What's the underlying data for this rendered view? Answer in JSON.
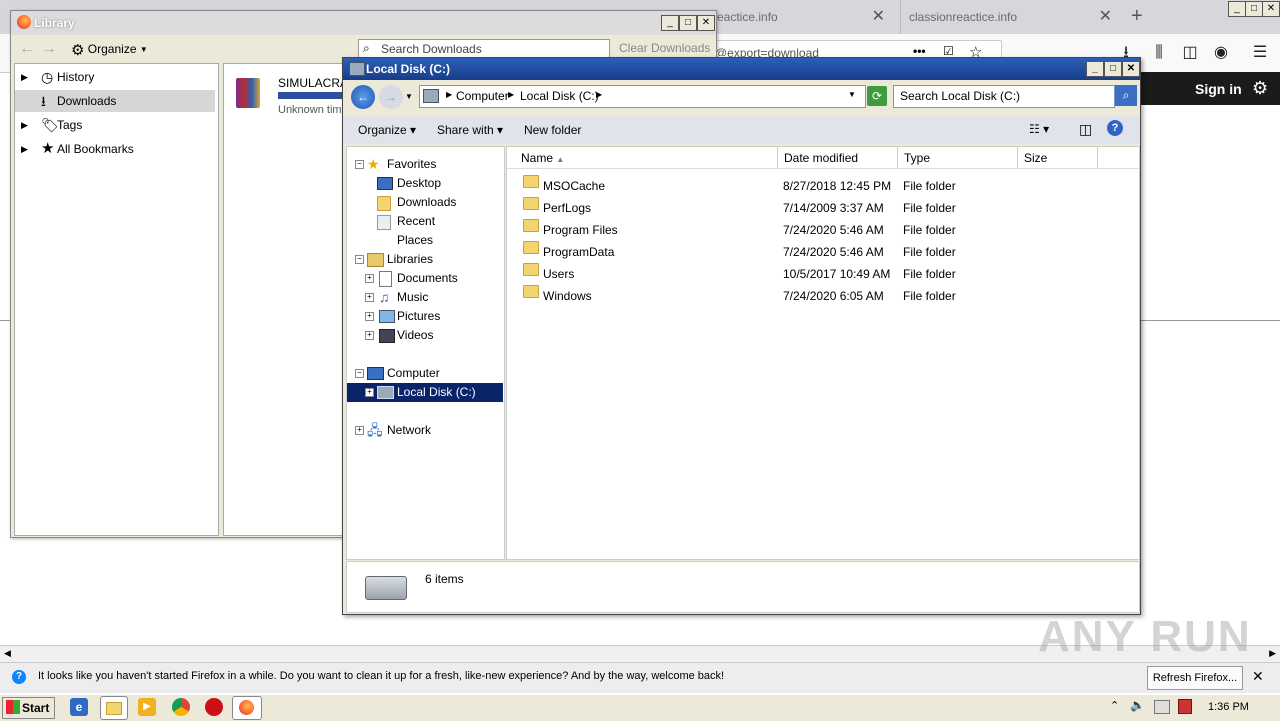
{
  "firefox": {
    "tabs": [
      {
        "label": "reactice.info"
      },
      {
        "label": "classionreactice.info"
      }
    ],
    "url_fragment": "@export=download",
    "sign_in": "Sign in",
    "notification": "It looks like you haven't started Firefox in a while. Do you want to clean it up for a fresh, like-new experience? And by the way, welcome back!",
    "refresh_button": "Refresh Firefox..."
  },
  "library": {
    "title": "Library",
    "organize": "Organize",
    "search_placeholder": "Search Downloads",
    "clear_downloads": "Clear Downloads",
    "sidebar": [
      {
        "label": "History",
        "icon": "clock-icon"
      },
      {
        "label": "Downloads",
        "icon": "download-icon"
      },
      {
        "label": "Tags",
        "icon": "tag-icon"
      },
      {
        "label": "All Bookmarks",
        "icon": "star-icon"
      }
    ],
    "download": {
      "name": "SIMULACRA.r",
      "status": "Unknown time"
    }
  },
  "explorer": {
    "title": "Local Disk (C:)",
    "breadcrumb": [
      "Computer",
      "Local Disk (C:)"
    ],
    "search_placeholder": "Search Local Disk (C:)",
    "commands": {
      "organize": "Organize",
      "share_with": "Share with",
      "new_folder": "New folder"
    },
    "nav": {
      "favorites": "Favorites",
      "favorites_items": [
        "Desktop",
        "Downloads",
        "Recent Places"
      ],
      "libraries": "Libraries",
      "libraries_items": [
        "Documents",
        "Music",
        "Pictures",
        "Videos"
      ],
      "computer": "Computer",
      "computer_items": [
        "Local Disk (C:)"
      ],
      "network": "Network"
    },
    "columns": {
      "name": "Name",
      "date": "Date modified",
      "type": "Type",
      "size": "Size"
    },
    "rows": [
      {
        "name": "MSOCache",
        "date": "8/27/2018 12:45 PM",
        "type": "File folder"
      },
      {
        "name": "PerfLogs",
        "date": "7/14/2009 3:37 AM",
        "type": "File folder"
      },
      {
        "name": "Program Files",
        "date": "7/24/2020 5:46 AM",
        "type": "File folder"
      },
      {
        "name": "ProgramData",
        "date": "7/24/2020 5:46 AM",
        "type": "File folder"
      },
      {
        "name": "Users",
        "date": "10/5/2017 10:49 AM",
        "type": "File folder"
      },
      {
        "name": "Windows",
        "date": "7/24/2020 6:05 AM",
        "type": "File folder"
      }
    ],
    "status": "6 items"
  },
  "taskbar": {
    "start": "Start",
    "clock": "1:36 PM"
  },
  "watermark": "ANY RUN"
}
